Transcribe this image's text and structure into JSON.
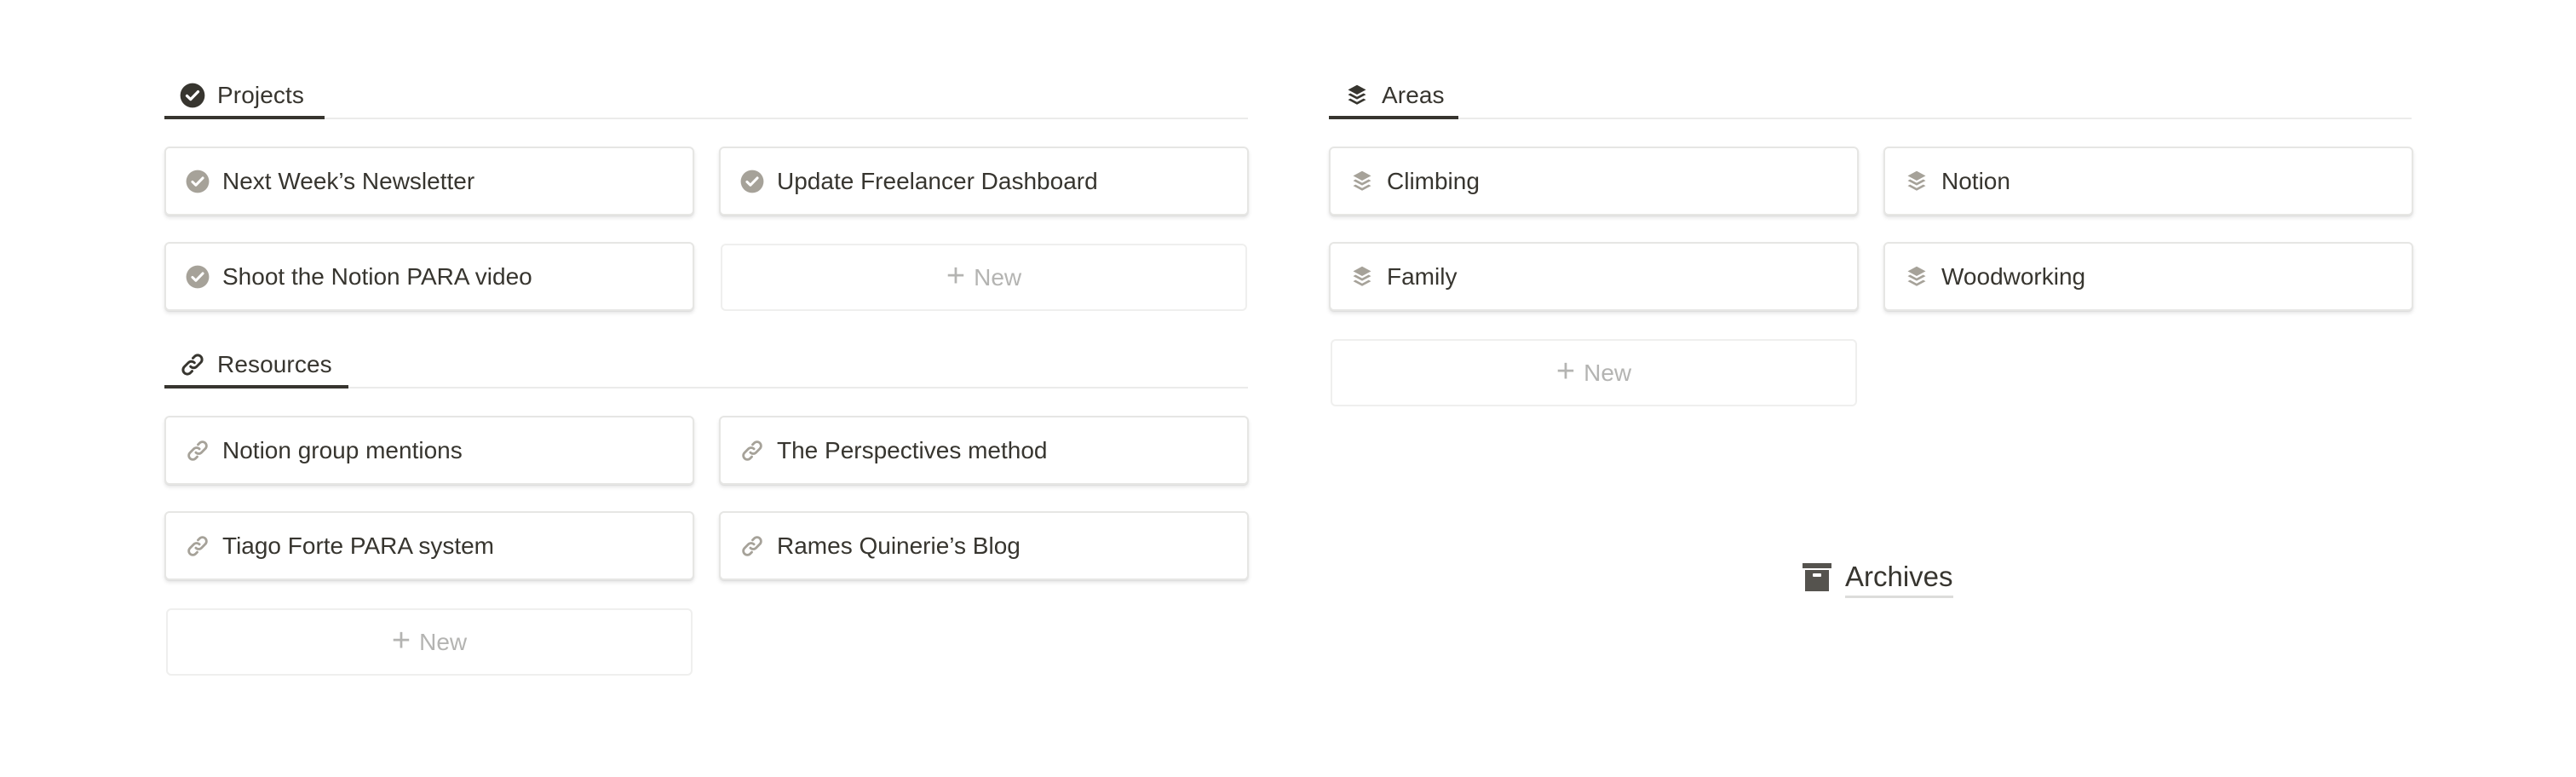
{
  "colors": {
    "text": "#37352f",
    "icon_muted": "#a6a299",
    "placeholder": "#b4b4b2",
    "divider": "#ebebea",
    "archive_icon": "#55534e"
  },
  "projects": {
    "title": "Projects",
    "icon": "check-circle-icon",
    "items": [
      {
        "label": "Next Week’s Newsletter",
        "icon": "check-circle-icon"
      },
      {
        "label": "Update Freelancer Dashboard",
        "icon": "check-circle-icon"
      },
      {
        "label": "Shoot the Notion PARA video",
        "icon": "check-circle-icon"
      }
    ],
    "new_label": "New"
  },
  "resources": {
    "title": "Resources",
    "icon": "link-icon",
    "items": [
      {
        "label": "Notion group mentions",
        "icon": "link-icon"
      },
      {
        "label": "The Perspectives method",
        "icon": "link-icon"
      },
      {
        "label": "Tiago Forte PARA system",
        "icon": "link-icon"
      },
      {
        "label": "Rames Quinerie’s Blog",
        "icon": "link-icon"
      }
    ],
    "new_label": "New"
  },
  "areas": {
    "title": "Areas",
    "icon": "layers-icon",
    "items": [
      {
        "label": "Climbing",
        "icon": "layers-icon"
      },
      {
        "label": "Notion",
        "icon": "layers-icon"
      },
      {
        "label": "Family",
        "icon": "layers-icon"
      },
      {
        "label": "Woodworking",
        "icon": "layers-icon"
      }
    ],
    "new_label": "New"
  },
  "archives": {
    "label": "Archives",
    "icon": "archive-box-icon"
  }
}
